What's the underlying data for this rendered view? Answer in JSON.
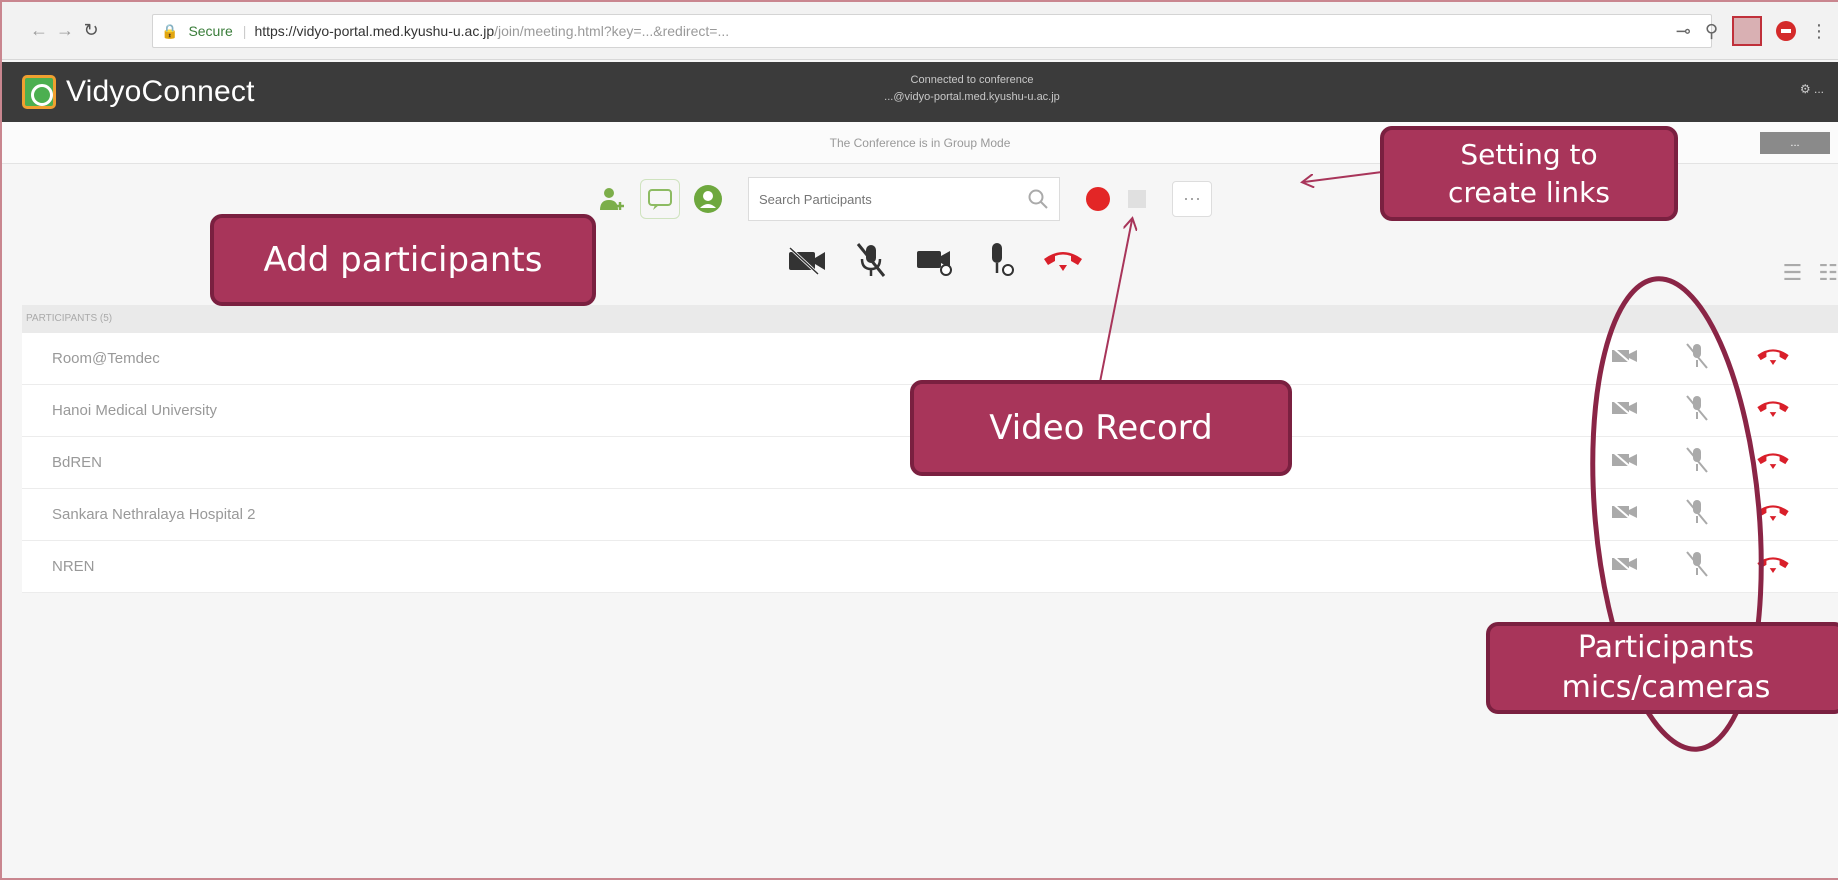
{
  "browser": {
    "secure_label": "Secure",
    "url_host": "https://vidyo-portal.med.kyushu-u.ac.jp",
    "url_rest": "/join/meeting.html?key=...&redirect=...",
    "reload_icon": "reload-icon"
  },
  "app": {
    "brand": "VidyoConnect",
    "conference_status": "Connected to conference",
    "conference_address": "...@vidyo-portal.med.kyushu-u.ac.jp",
    "header_right": "..."
  },
  "mode_bar": {
    "text": "The Conference is in Group Mode",
    "toggle_label": "..."
  },
  "toolbar": {
    "search_placeholder": "Search Participants",
    "more_label": "···"
  },
  "participants": {
    "header": "PARTICIPANTS (5)",
    "rows": [
      {
        "name": "Room@Temdec"
      },
      {
        "name": "Hanoi Medical University"
      },
      {
        "name": "BdREN"
      },
      {
        "name": "Sankara Nethralaya Hospital 2"
      },
      {
        "name": "NREN"
      }
    ]
  },
  "callouts": {
    "add_participants": "Add participants",
    "create_links_line1": "Setting to",
    "create_links_line2": "create links",
    "video_record": "Video Record",
    "mics_line1": "Participants",
    "mics_line2": "mics/cameras"
  },
  "colors": {
    "callout_fill": "#a8355a",
    "callout_border": "#7a2040",
    "record_red": "#e32626",
    "hangup_red": "#d91f2a",
    "header_dark": "#3b3b3b"
  }
}
